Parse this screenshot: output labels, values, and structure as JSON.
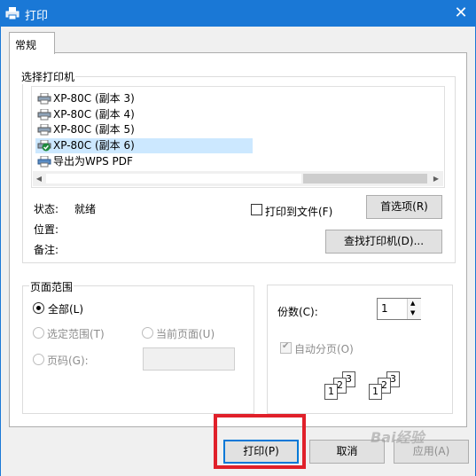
{
  "window": {
    "title": "打印",
    "close_glyph": "✕"
  },
  "tabs": [
    {
      "label": "常规"
    }
  ],
  "printer_group": {
    "title": "选择打印机",
    "printers": [
      {
        "label": "XP-80C (副本 3)"
      },
      {
        "label": "XP-80C (副本 4)"
      },
      {
        "label": "XP-80C (副本 5)"
      },
      {
        "label": "XP-80C (副本 6)",
        "selected": true,
        "default": true
      },
      {
        "label": "导出为WPS PDF"
      }
    ],
    "status_label": "状态:",
    "status_value": "就绪",
    "location_label": "位置:",
    "comment_label": "备注:",
    "print_to_file_label": "打印到文件(F)",
    "print_to_file_checked": false,
    "preferences_button": "首选项(R)",
    "find_printer_button": "查找打印机(D)..."
  },
  "page_range": {
    "title": "页面范围",
    "all_label": "全部(L)",
    "selection_label": "选定范围(T)",
    "current_page_label": "当前页面(U)",
    "pages_label": "页码(G):",
    "pages_value": "",
    "selected": "all"
  },
  "copies": {
    "label": "份数(C):",
    "value": "1",
    "collate_label": "自动分页(O)",
    "collate_checked": true,
    "collate_icon_numbers": [
      "1",
      "2",
      "3"
    ]
  },
  "footer": {
    "print_button": "打印(P)",
    "cancel_button": "取消",
    "apply_button": "应用(A)"
  },
  "watermark": "Bai经验",
  "colors": {
    "titlebar": "#1a78d6",
    "selection": "#cce8ff",
    "highlight": "#e0202a"
  }
}
